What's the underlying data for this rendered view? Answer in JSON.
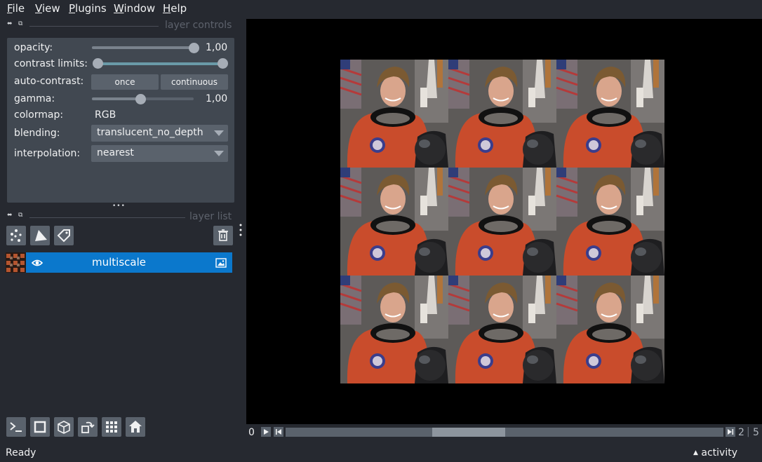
{
  "menu": [
    {
      "label": "File",
      "underline": "F",
      "rest": "ile"
    },
    {
      "label": "View",
      "underline": "V",
      "rest": "iew"
    },
    {
      "label": "Plugins",
      "underline": "P",
      "rest": "lugins"
    },
    {
      "label": "Window",
      "underline": "W",
      "rest": "indow"
    },
    {
      "label": "Help",
      "underline": "H",
      "rest": "elp"
    }
  ],
  "layer_controls": {
    "title": "layer controls",
    "opacity": {
      "label": "opacity:",
      "value": "1,00",
      "fraction": 1.0
    },
    "contrast_limits": {
      "label": "contrast limits:",
      "low": 0.0,
      "high": 1.0
    },
    "auto_contrast": {
      "label": "auto-contrast:",
      "once": "once",
      "continuous": "continuous"
    },
    "gamma": {
      "label": "gamma:",
      "value": "1,00",
      "fraction": 0.48
    },
    "colormap": {
      "label": "colormap:",
      "value": "RGB"
    },
    "blending": {
      "label": "blending:",
      "value": "translucent_no_depth"
    },
    "interpolation": {
      "label": "interpolation:",
      "value": "nearest"
    },
    "splitter": "•••"
  },
  "layer_list": {
    "title": "layer list",
    "layers": [
      {
        "name": "multiscale",
        "visible": true,
        "type_icon": "image-icon"
      }
    ]
  },
  "dims": {
    "current": "0",
    "right_a": "2",
    "right_b": "5",
    "scroll_fraction": 0.34
  },
  "status": {
    "ready": "Ready",
    "activity": "activity"
  },
  "colors": {
    "accent": "#0b78cc",
    "background": "#262930",
    "panel": "#414851"
  }
}
